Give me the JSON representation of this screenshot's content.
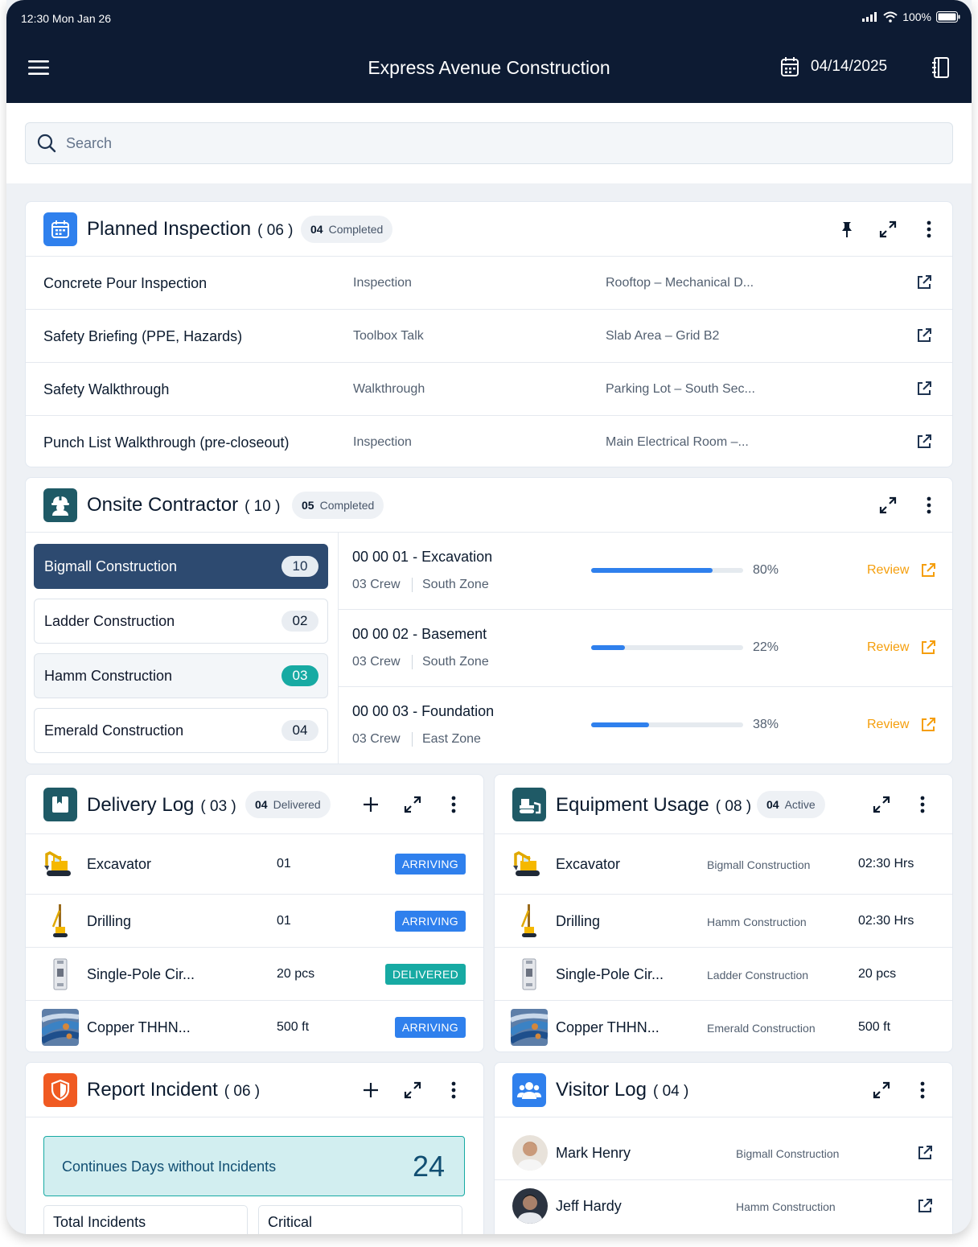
{
  "status": {
    "time": "12:30 Mon Jan 26",
    "battery": "100%"
  },
  "header": {
    "title": "Express Avenue Construction",
    "date": "04/14/2025"
  },
  "search": {
    "placeholder": "Search"
  },
  "planned_inspection": {
    "title": "Planned Inspection",
    "count": "( 06 )",
    "badge_num": "04",
    "badge_label": "Completed",
    "rows": [
      {
        "name": "Concrete Pour Inspection",
        "type": "Inspection",
        "location": "Rooftop – Mechanical D..."
      },
      {
        "name": "Safety Briefing (PPE, Hazards)",
        "type": "Toolbox Talk",
        "location": "Slab Area – Grid B2"
      },
      {
        "name": "Safety Walkthrough",
        "type": "Walkthrough",
        "location": "Parking Lot – South Sec..."
      },
      {
        "name": "Punch List Walkthrough (pre-closeout)",
        "type": "Inspection",
        "location": "Main Electrical Room –..."
      }
    ]
  },
  "onsite_contractor": {
    "title": "Onsite Contractor",
    "count": "( 10 )",
    "badge_num": "05",
    "badge_label": "Completed",
    "contractors": [
      {
        "name": "Bigmall Construction",
        "count": "10"
      },
      {
        "name": "Ladder Construction",
        "count": "02"
      },
      {
        "name": "Hamm Construction",
        "count": "03"
      },
      {
        "name": "Emerald Construction",
        "count": "04"
      }
    ],
    "tasks": [
      {
        "title": "00 00 01 - Excavation",
        "crew": "03 Crew",
        "zone": "South Zone",
        "progress": 80,
        "progress_label": "80%",
        "action": "Review"
      },
      {
        "title": "00 00 02 - Basement",
        "crew": "03 Crew",
        "zone": "South Zone",
        "progress": 22,
        "progress_label": "22%",
        "action": "Review"
      },
      {
        "title": "00 00 03 - Foundation",
        "crew": "03 Crew",
        "zone": "East Zone",
        "progress": 38,
        "progress_label": "38%",
        "action": "Review"
      }
    ]
  },
  "delivery_log": {
    "title": "Delivery Log",
    "count": "( 03 )",
    "badge_num": "04",
    "badge_label": "Delivered",
    "rows": [
      {
        "item": "Excavator",
        "qty": "01",
        "status": "ARRIVING",
        "status_color": "#2f80ed",
        "icon": "excavator-icon"
      },
      {
        "item": "Drilling",
        "qty": "01",
        "status": "ARRIVING",
        "status_color": "#2f80ed",
        "icon": "drill-rig-icon"
      },
      {
        "item": "Single-Pole Cir...",
        "qty": "20 pcs",
        "status": "DELIVERED",
        "status_color": "#17aaa3",
        "icon": "circuit-breaker-icon"
      },
      {
        "item": "Copper THHN...",
        "qty": "500 ft",
        "status": "ARRIVING",
        "status_color": "#2f80ed",
        "icon": "copper-wire-icon"
      }
    ]
  },
  "equipment_usage": {
    "title": "Equipment Usage",
    "count": "( 08 )",
    "badge_num": "04",
    "badge_label": "Active",
    "rows": [
      {
        "item": "Excavator",
        "company": "Bigmall Construction",
        "value": "02:30 Hrs",
        "icon": "excavator-icon"
      },
      {
        "item": "Drilling",
        "company": "Hamm Construction",
        "value": "02:30 Hrs",
        "icon": "drill-rig-icon"
      },
      {
        "item": "Single-Pole Cir...",
        "company": "Ladder Construction",
        "value": "20 pcs",
        "icon": "circuit-breaker-icon"
      },
      {
        "item": "Copper THHN...",
        "company": "Emerald Construction",
        "value": "500 ft",
        "icon": "copper-wire-icon"
      }
    ]
  },
  "report_incident": {
    "title": "Report Incident",
    "count": "( 06 )",
    "streak_label": "Continues Days without Incidents",
    "streak_value": "24",
    "stat_total": "Total Incidents",
    "stat_critical": "Critical"
  },
  "visitor_log": {
    "title": "Visitor Log",
    "count": "( 04 )",
    "rows": [
      {
        "name": "Mark Henry",
        "company": "Bigmall Construction"
      },
      {
        "name": "Jeff Hardy",
        "company": "Hamm Construction"
      }
    ]
  },
  "colors": {
    "header_bg": "#0d1b33",
    "accent_blue": "#2f80ed",
    "teal": "#17aaa3",
    "review_orange": "#f59e0b",
    "incident_orange": "#f05a22"
  }
}
